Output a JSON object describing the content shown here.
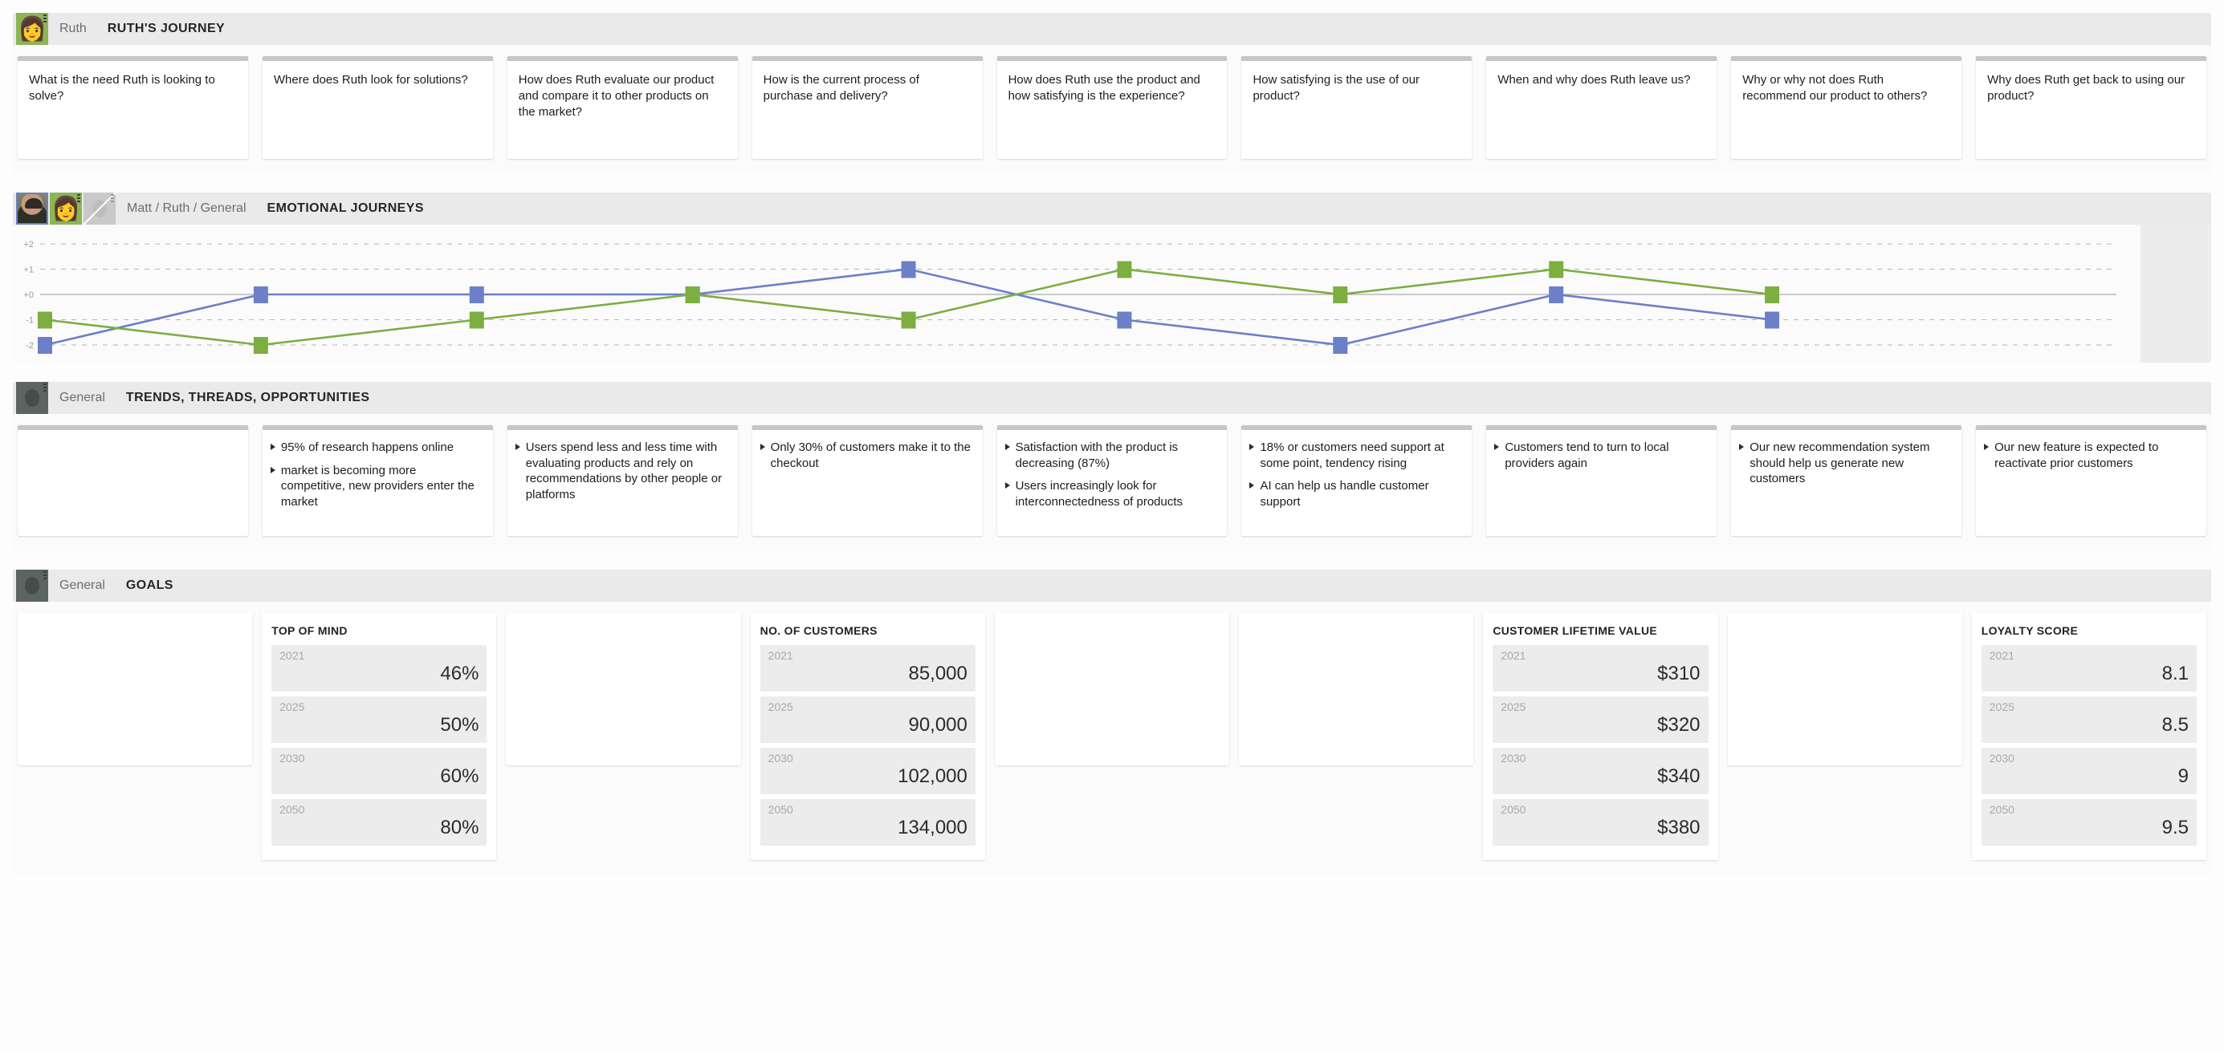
{
  "journey": {
    "owner": "Ruth",
    "title": "RUTH'S JOURNEY",
    "avatars": [
      "ruth-avatar"
    ],
    "stages": [
      "What is the need Ruth is looking to solve?",
      "Where does Ruth look for solutions?",
      "How does Ruth evaluate our product and compare it to other products on the market?",
      "How is the current process of purchase and delivery?",
      "How does Ruth use the product and how satisfying is the experience?",
      "How satisfying is the use of our product?",
      "When and why does Ruth leave us?",
      "Why or why not does Ruth recommend our product to others?",
      "Why does Ruth get back to using our product?"
    ]
  },
  "emotional": {
    "owner": "Matt / Ruth / General",
    "title": "EMOTIONAL JOURNEYS",
    "avatars": [
      "matt-avatar",
      "ruth-avatar",
      "empty-avatar"
    ]
  },
  "chart_data": {
    "type": "line",
    "title": "EMOTIONAL JOURNEYS",
    "xlabel": "",
    "ylabel": "",
    "ylim": [
      -2,
      2
    ],
    "ytick_labels": [
      "+2",
      "+1",
      "+0",
      "-1",
      "-2"
    ],
    "ytick_values": [
      2,
      1,
      0,
      -1,
      -2
    ],
    "grid": true,
    "legend": "none",
    "categories": [
      "1",
      "2",
      "3",
      "4",
      "5",
      "6",
      "7",
      "8",
      "9",
      "10"
    ],
    "series": [
      {
        "name": "Matt",
        "color": "#6b80c9",
        "values": [
          -2,
          0,
          0,
          0,
          1,
          -1,
          -2,
          0,
          -1
        ]
      },
      {
        "name": "Ruth",
        "color": "#7cae42",
        "values": [
          -1,
          -2,
          -1,
          0,
          -1,
          1,
          0,
          1,
          0
        ]
      }
    ]
  },
  "trends": {
    "owner": "General",
    "title": "TRENDS, THREADS, OPPORTUNITIES",
    "columns": [
      {
        "bullets": []
      },
      {
        "bullets": [
          "95% of research happens online",
          "market is becoming more competitive, new providers enter the market"
        ]
      },
      {
        "bullets": [
          "Users spend less and less time with evaluating products and rely on recommendations by other people or platforms"
        ]
      },
      {
        "bullets": [
          "Only 30% of customers make it to the checkout"
        ]
      },
      {
        "bullets": [
          "Satisfaction with the product is decreasing (87%)",
          "Users increasingly look for interconnectedness of products"
        ]
      },
      {
        "bullets": [
          "18% or customers need support at some point, tendency rising",
          "AI can help us handle customer support"
        ]
      },
      {
        "bullets": [
          "Customers tend to turn to local providers again"
        ]
      },
      {
        "bullets": [
          "Our new recommendation system should help us generate new customers"
        ]
      },
      {
        "bullets": [
          "Our new feature is expected to reactivate prior customers"
        ]
      }
    ]
  },
  "goals": {
    "owner": "General",
    "title": "GOALS",
    "years": [
      "2021",
      "2025",
      "2030",
      "2050"
    ],
    "columns": [
      {
        "title": "",
        "values": []
      },
      {
        "title": "TOP OF MIND",
        "values": [
          "46%",
          "50%",
          "60%",
          "80%"
        ]
      },
      {
        "title": "",
        "values": []
      },
      {
        "title": "NO. OF CUSTOMERS",
        "values": [
          "85,000",
          "90,000",
          "102,000",
          "134,000"
        ]
      },
      {
        "title": "",
        "values": []
      },
      {
        "title": "",
        "values": []
      },
      {
        "title": "CUSTOMER LIFETIME VALUE",
        "values": [
          "$310",
          "$320",
          "$340",
          "$380"
        ]
      },
      {
        "title": "",
        "values": []
      },
      {
        "title": "LOYALTY SCORE",
        "values": [
          "8.1",
          "8.5",
          "9",
          "9.5"
        ]
      }
    ]
  },
  "colors": {
    "matt_line": "#6b80c9",
    "ruth_line": "#7cae42",
    "card_top": "#c6c6c6",
    "header_bg": "#eaeaea"
  }
}
